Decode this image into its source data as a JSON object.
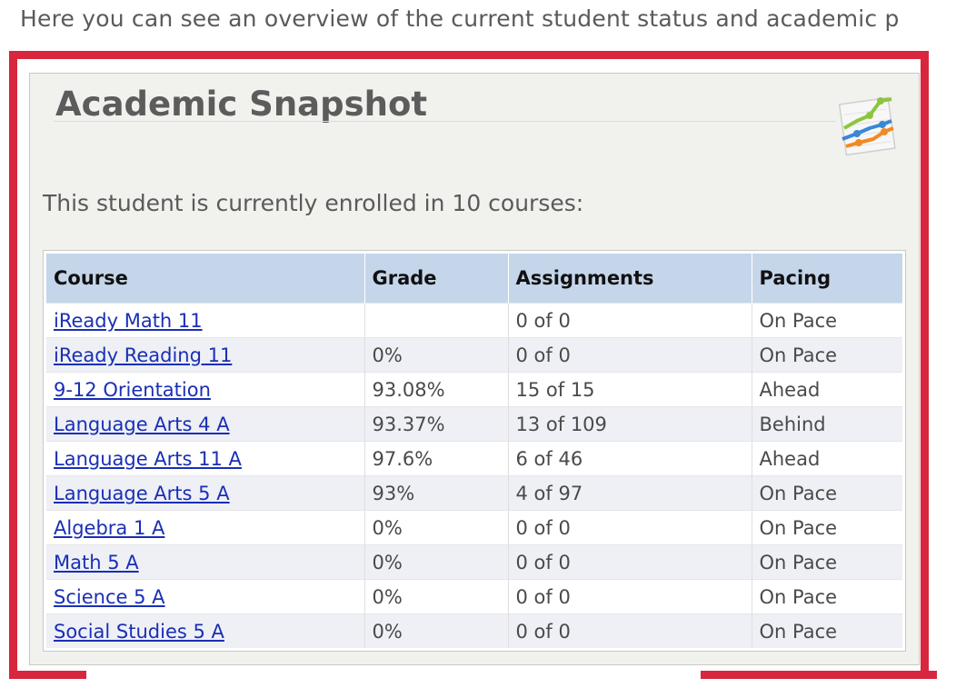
{
  "intro_text": "Here you can see an overview of the current student status and academic p",
  "panel": {
    "title": "Academic Snapshot",
    "enrollment_text": "This student is currently enrolled in 10 courses:",
    "icon": "chart-icon"
  },
  "colors": {
    "highlight": "#d7263d",
    "header_bg": "#c5d6ea",
    "link": "#1a2fb5"
  },
  "table": {
    "headers": [
      "Course",
      "Grade",
      "Assignments",
      "Pacing"
    ],
    "rows": [
      {
        "course": "iReady Math 11",
        "grade": "",
        "assignments": "0 of 0",
        "pacing": "On Pace"
      },
      {
        "course": "iReady Reading 11",
        "grade": "0%",
        "assignments": "0 of 0",
        "pacing": "On Pace"
      },
      {
        "course": "9-12 Orientation",
        "grade": "93.08%",
        "assignments": "15 of 15",
        "pacing": "Ahead"
      },
      {
        "course": "Language Arts 4 A",
        "grade": "93.37%",
        "assignments": "13 of 109",
        "pacing": "Behind"
      },
      {
        "course": "Language Arts 11 A",
        "grade": "97.6%",
        "assignments": "6 of 46",
        "pacing": "Ahead"
      },
      {
        "course": "Language Arts 5 A",
        "grade": "93%",
        "assignments": "4 of 97",
        "pacing": "On Pace"
      },
      {
        "course": "Algebra 1 A",
        "grade": "0%",
        "assignments": "0 of 0",
        "pacing": "On Pace"
      },
      {
        "course": "Math 5 A",
        "grade": "0%",
        "assignments": "0 of 0",
        "pacing": "On Pace"
      },
      {
        "course": "Science 5 A",
        "grade": "0%",
        "assignments": "0 of 0",
        "pacing": "On Pace"
      },
      {
        "course": "Social Studies 5 A",
        "grade": "0%",
        "assignments": "0 of 0",
        "pacing": "On Pace"
      }
    ]
  }
}
